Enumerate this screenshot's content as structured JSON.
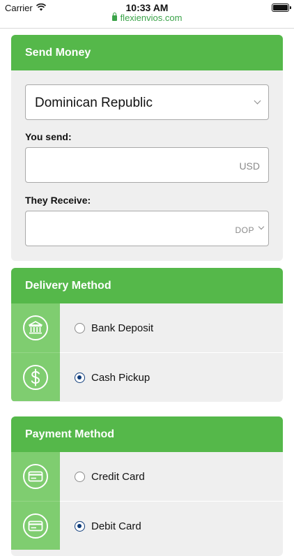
{
  "status": {
    "carrier": "Carrier",
    "time": "10:33 AM"
  },
  "browser": {
    "url": "flexienvios.com"
  },
  "send_money": {
    "title": "Send Money",
    "country": "Dominican Republic",
    "you_send_label": "You send:",
    "you_send_value": "",
    "send_currency": "USD",
    "they_receive_label": "They Receive:",
    "they_receive_value": "",
    "receive_currency": "DOP"
  },
  "delivery_method": {
    "title": "Delivery Method",
    "options": [
      {
        "label": "Bank Deposit",
        "icon": "bank-icon",
        "selected": false
      },
      {
        "label": "Cash Pickup",
        "icon": "dollar-icon",
        "selected": true
      }
    ]
  },
  "payment_method": {
    "title": "Payment Method",
    "options": [
      {
        "label": "Credit Card",
        "icon": "credit-card-icon",
        "selected": false
      },
      {
        "label": "Debit Card",
        "icon": "debit-card-icon",
        "selected": true
      }
    ]
  },
  "colors": {
    "brand_green": "#55b84a",
    "icon_green": "#7fcd70",
    "radio_blue": "#0d3b7a"
  }
}
